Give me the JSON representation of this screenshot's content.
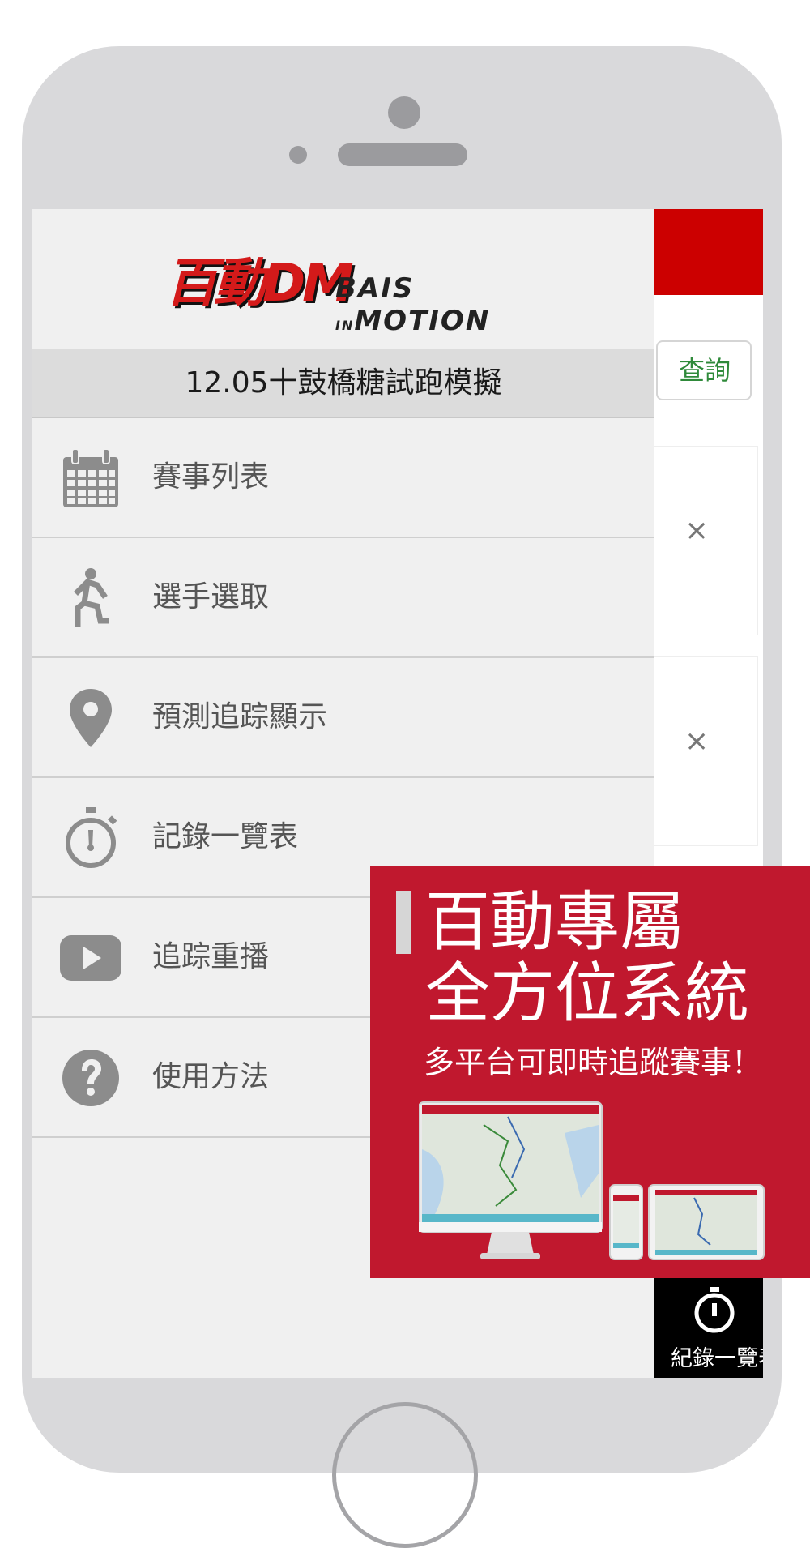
{
  "app": {
    "logo": {
      "cn": "百動DM",
      "en_main": "BAIS",
      "en_small": "IN",
      "en_tail": "MOTION"
    },
    "event_title": "12.05十鼓橋糖試跑模擬"
  },
  "background": {
    "query_label": "查詢",
    "close_symbol": "×",
    "bottom_tab_label": "紀錄一覽表"
  },
  "menu": {
    "items": [
      {
        "label": "賽事列表",
        "icon": "calendar-icon"
      },
      {
        "label": "選手選取",
        "icon": "runner-icon"
      },
      {
        "label": "預測追踪顯示",
        "icon": "map-pin-icon"
      },
      {
        "label": "記錄一覽表",
        "icon": "stopwatch-icon"
      },
      {
        "label": "追踪重播",
        "icon": "play-video-icon"
      },
      {
        "label": "使用方法",
        "icon": "help-icon"
      }
    ]
  },
  "ad": {
    "title_line1": "百動專屬",
    "title_line2": "全方位系統",
    "subtitle": "多平台可即時追蹤賽事！"
  },
  "colors": {
    "brand_red": "#cc0000",
    "ad_red": "#c0182e",
    "drawer_bg": "#f0f0f0",
    "icon_gray": "#8c8c8c"
  }
}
